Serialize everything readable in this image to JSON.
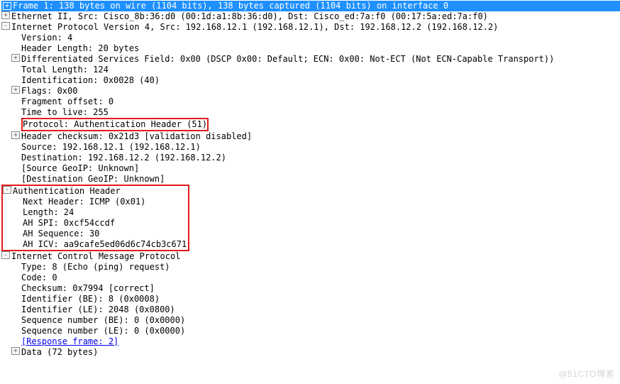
{
  "frame": {
    "summary": "Frame 1: 138 bytes on wire (1104 bits), 138 bytes captured (1104 bits) on interface 0"
  },
  "ethernet": {
    "summary": "Ethernet II, Src: Cisco_8b:36:d0 (00:1d:a1:8b:36:d0), Dst: Cisco_ed:7a:f0 (00:17:5a:ed:7a:f0)"
  },
  "ip": {
    "summary": "Internet Protocol Version 4, Src: 192.168.12.1 (192.168.12.1), Dst: 192.168.12.2 (192.168.12.2)",
    "version": "Version: 4",
    "header_length": "Header Length: 20 bytes",
    "dsfield": "Differentiated Services Field: 0x00 (DSCP 0x00: Default; ECN: 0x00: Not-ECT (Not ECN-Capable Transport))",
    "total_length": "Total Length: 124",
    "identification": "Identification: 0x0028 (40)",
    "flags": "Flags: 0x00",
    "frag_offset": "Fragment offset: 0",
    "ttl": "Time to live: 255",
    "protocol": "Protocol: Authentication Header (51)",
    "checksum": "Header checksum: 0x21d3 [validation disabled]",
    "source": "Source: 192.168.12.1 (192.168.12.1)",
    "destination": "Destination: 192.168.12.2 (192.168.12.2)",
    "src_geoip": "[Source GeoIP: Unknown]",
    "dst_geoip": "[Destination GeoIP: Unknown]"
  },
  "ah": {
    "summary": "Authentication Header",
    "next_header": "Next Header: ICMP (0x01)",
    "length": "Length: 24",
    "spi": "AH SPI: 0xcf54ccdf",
    "sequence": "AH Sequence: 30",
    "icv": "AH ICV: aa9cafe5ed06d6c74cb3c671"
  },
  "icmp": {
    "summary": "Internet Control Message Protocol",
    "type": "Type: 8 (Echo (ping) request)",
    "code": "Code: 0",
    "checksum": "Checksum: 0x7994 [correct]",
    "id_be": "Identifier (BE): 8 (0x0008)",
    "id_le": "Identifier (LE): 2048 (0x0800)",
    "seq_be": "Sequence number (BE): 0 (0x0000)",
    "seq_le": "Sequence number (LE): 0 (0x0000)",
    "response_link": "[Response frame: 2]"
  },
  "data": {
    "summary": "Data (72 bytes)"
  },
  "watermark": "@51CTO博客"
}
